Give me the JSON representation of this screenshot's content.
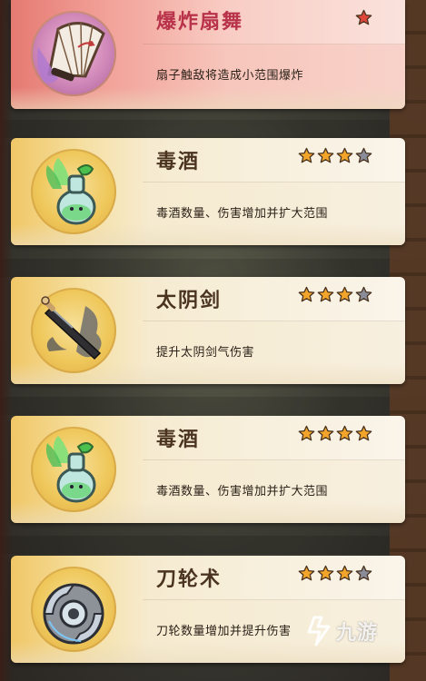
{
  "cards": [
    {
      "title": "爆炸扇舞",
      "description": "扇子触敌将造成小范围爆炸",
      "stars_filled": 1,
      "stars_total": 1,
      "icon": "folding-fan-icon"
    },
    {
      "title": "毒酒",
      "description": "毒酒数量、伤害增加并扩大范围",
      "stars_filled": 3,
      "stars_total": 4,
      "icon": "poison-wine-gourd-icon"
    },
    {
      "title": "太阴剑",
      "description": "提升太阴剑气伤害",
      "stars_filled": 3,
      "stars_total": 4,
      "icon": "sword-icon"
    },
    {
      "title": "毒酒",
      "description": "毒酒数量、伤害增加并扩大范围",
      "stars_filled": 4,
      "stars_total": 4,
      "icon": "poison-wine-gourd-icon"
    },
    {
      "title": "刀轮术",
      "description": "刀轮数量增加并提升伤害",
      "stars_filled": 3,
      "stars_total": 4,
      "icon": "blade-wheel-icon"
    }
  ],
  "watermark": {
    "text": "九游",
    "icon": "jiuyou-logo-icon"
  },
  "colors": {
    "star_filled": "#f2a52a",
    "star_empty": "#8a8d99",
    "top_star": "#e0453a"
  }
}
